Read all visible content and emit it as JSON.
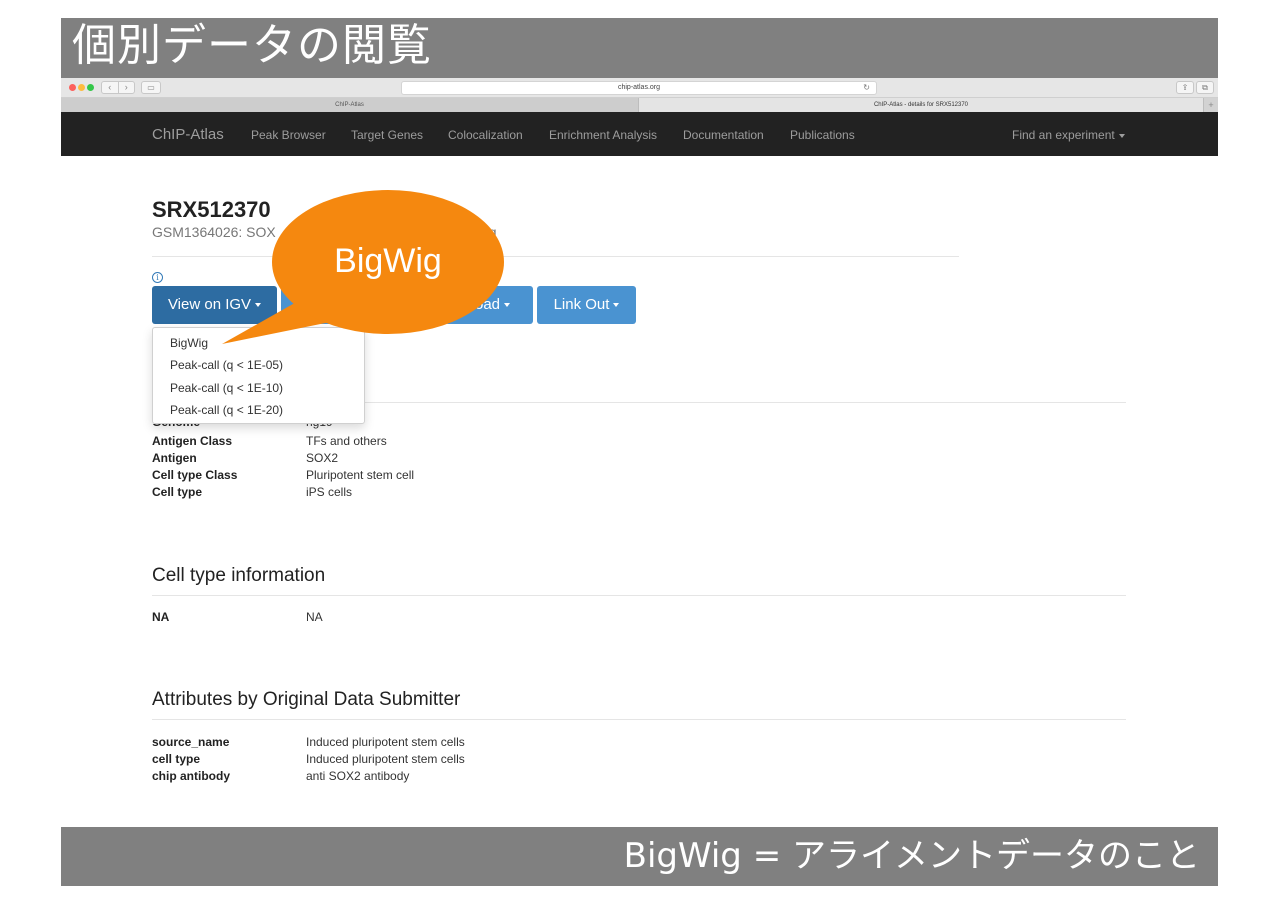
{
  "slide": {
    "title": "個別データの閲覧",
    "caption": "BigWig = アライメントデータのこと",
    "callout": "BigWig"
  },
  "browser": {
    "url": "chip-atlas.org",
    "tabs": [
      "ChIP-Atlas",
      "ChIP-Atlas - details for SRX512370"
    ]
  },
  "navbar": {
    "brand": "ChIP-Atlas",
    "items": [
      "Peak Browser",
      "Target Genes",
      "Colocalization",
      "Enrichment Analysis",
      "Documentation",
      "Publications"
    ],
    "right": "Find an experiment"
  },
  "experiment": {
    "id": "SRX512370",
    "subtitle_left": "GSM1364026: SOX",
    "subtitle_right": "eq"
  },
  "buttons": {
    "view_igv": "View on IGV",
    "download": "oad",
    "link_out": "Link Out"
  },
  "dropdown": [
    "BigWig",
    "Peak-call (q < 1E-05)",
    "Peak-call (q < 1E-10)",
    "Peak-call (q < 1E-20)"
  ],
  "metadata": {
    "partial": {
      "key": "Genome",
      "value": "hg19"
    },
    "rows": [
      {
        "key": "Antigen Class",
        "value": "TFs and others"
      },
      {
        "key": "Antigen",
        "value": "SOX2"
      },
      {
        "key": "Cell type Class",
        "value": "Pluripotent stem cell"
      },
      {
        "key": "Cell type",
        "value": "iPS cells"
      }
    ]
  },
  "cell_type_info": {
    "heading": "Cell type information",
    "rows": [
      {
        "key": "NA",
        "value": "NA"
      }
    ]
  },
  "attributes": {
    "heading": "Attributes by Original Data Submitter",
    "rows": [
      {
        "key": "source_name",
        "value": "Induced pluripotent stem cells"
      },
      {
        "key": "cell type",
        "value": "Induced pluripotent stem cells"
      },
      {
        "key": "chip antibody",
        "value": "anti SOX2 antibody"
      }
    ]
  },
  "colors": {
    "slide_band": "#808080",
    "navbar": "#222222",
    "primary_button": "#4a93d1",
    "active_button": "#2d6ca2",
    "callout": "#f5880f"
  }
}
